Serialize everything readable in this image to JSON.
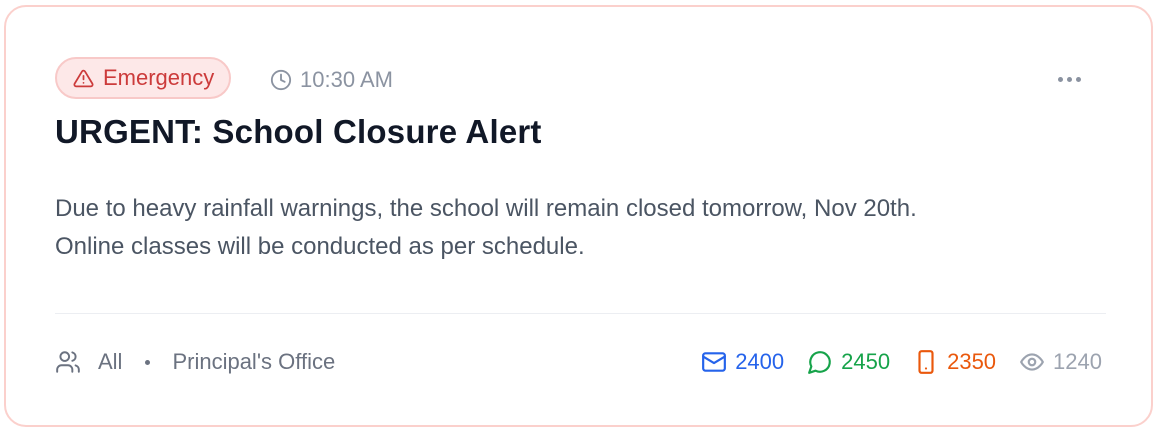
{
  "notice": {
    "badge_label": "Emergency",
    "time": "10:30 AM",
    "title": "URGENT: School Closure Alert",
    "body_line1": "Due to heavy rainfall warnings, the school will remain closed tomorrow, Nov 20th.",
    "body_line2": "Online classes will be conducted as per schedule.",
    "audience": "All",
    "sender": "Principal's Office",
    "stats": {
      "email": "2400",
      "message": "2450",
      "sms": "2350",
      "views": "1240"
    }
  },
  "icons": {
    "badge": "alert-triangle-icon",
    "time": "clock-icon",
    "menu": "more-horizontal-icon",
    "audience": "users-icon",
    "email": "mail-icon",
    "message": "chat-bubble-icon",
    "sms": "smartphone-icon",
    "views": "eye-icon"
  },
  "colors": {
    "badge_text": "#cc3b3b",
    "badge_bg": "#fde8e8",
    "card_border": "#fbd0cc",
    "email": "#2563eb",
    "message": "#16a34a",
    "sms": "#ea580c",
    "views": "#9ca3af"
  }
}
